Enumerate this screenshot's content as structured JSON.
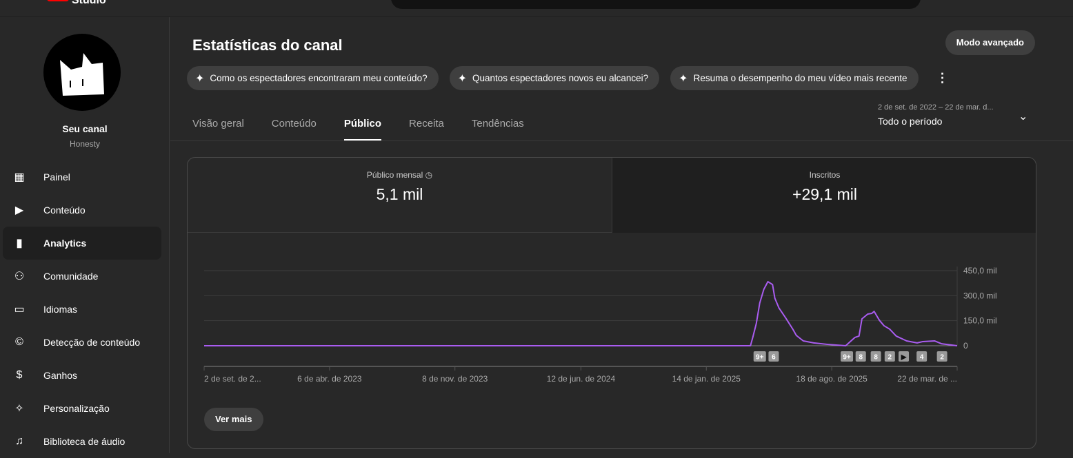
{
  "header": {
    "logo_text": "Studio"
  },
  "sidebar": {
    "channel_name": "Seu canal",
    "channel_handle": "Honesty",
    "items": [
      {
        "label": "Painel",
        "icon": "dashboard-icon"
      },
      {
        "label": "Conteúdo",
        "icon": "content-icon"
      },
      {
        "label": "Analytics",
        "icon": "analytics-icon",
        "active": true
      },
      {
        "label": "Comunidade",
        "icon": "community-icon"
      },
      {
        "label": "Idiomas",
        "icon": "subtitles-icon"
      },
      {
        "label": "Detecção de conteúdo",
        "icon": "copyright-icon"
      },
      {
        "label": "Ganhos",
        "icon": "dollar-icon"
      },
      {
        "label": "Personalização",
        "icon": "magic-wand-icon"
      },
      {
        "label": "Biblioteca de áudio",
        "icon": "audio-library-icon"
      }
    ]
  },
  "main": {
    "title": "Estatísticas do canal",
    "advanced_button": "Modo avançado",
    "chips": [
      "Como os espectadores encontraram meu conteúdo?",
      "Quantos espectadores novos eu alcancei?",
      "Resuma o desempenho do meu vídeo mais recente"
    ],
    "tabs": [
      "Visão geral",
      "Conteúdo",
      "Público",
      "Receita",
      "Tendências"
    ],
    "active_tab": "Público",
    "date_range": "2 de set. de 2022 – 22 de mar. d...",
    "period": "Todo o período",
    "metrics": [
      {
        "label": "Público mensal",
        "value": "5,1 mil"
      },
      {
        "label": "Inscritos",
        "value": "+29,1 mil"
      }
    ],
    "see_more": "Ver mais"
  },
  "chart_data": {
    "type": "line",
    "series_color": "#a95cf0",
    "x_unit": "days since 2 de set. de 2022",
    "xlim": [
      0,
      1297
    ],
    "ylim": [
      0,
      450
    ],
    "yunit": "mil",
    "ytick_values": [
      0,
      150,
      300,
      450
    ],
    "ytick_labels": [
      "0",
      "150,0 mil",
      "300,0 mil",
      "450,0 mil"
    ],
    "xticks": [
      {
        "day": 0,
        "label": "2 de set. de 2..."
      },
      {
        "day": 216,
        "label": "6 de abr. de 2023"
      },
      {
        "day": 432,
        "label": "8 de nov. de 2023"
      },
      {
        "day": 649,
        "label": "12 de jun. de 2024"
      },
      {
        "day": 865,
        "label": "14 de jan. de 2025"
      },
      {
        "day": 1081,
        "label": "18 de ago. de 2025"
      },
      {
        "day": 1297,
        "label": "22 de mar. de ..."
      }
    ],
    "points": [
      [
        0,
        0
      ],
      [
        941,
        0
      ],
      [
        945,
        50
      ],
      [
        951,
        132
      ],
      [
        957,
        256
      ],
      [
        964,
        338
      ],
      [
        971,
        384
      ],
      [
        979,
        367
      ],
      [
        983,
        285
      ],
      [
        990,
        227
      ],
      [
        1002,
        165
      ],
      [
        1014,
        99
      ],
      [
        1020,
        62
      ],
      [
        1032,
        29
      ],
      [
        1050,
        17
      ],
      [
        1074,
        8
      ],
      [
        1105,
        0
      ],
      [
        1121,
        50
      ],
      [
        1128,
        58
      ],
      [
        1133,
        161
      ],
      [
        1143,
        190
      ],
      [
        1150,
        194
      ],
      [
        1154,
        206
      ],
      [
        1163,
        153
      ],
      [
        1171,
        120
      ],
      [
        1181,
        99
      ],
      [
        1192,
        58
      ],
      [
        1210,
        29
      ],
      [
        1228,
        17
      ],
      [
        1238,
        25
      ],
      [
        1258,
        29
      ],
      [
        1270,
        12
      ],
      [
        1297,
        0
      ]
    ],
    "markers": [
      {
        "day": 957,
        "label": "9+"
      },
      {
        "day": 981,
        "label": "6"
      },
      {
        "day": 1107,
        "label": "9+"
      },
      {
        "day": 1131,
        "label": "8"
      },
      {
        "day": 1157,
        "label": "8"
      },
      {
        "day": 1181,
        "label": "2"
      },
      {
        "day": 1205,
        "label": "▶"
      },
      {
        "day": 1236,
        "label": "4"
      },
      {
        "day": 1271,
        "label": "2"
      }
    ]
  }
}
